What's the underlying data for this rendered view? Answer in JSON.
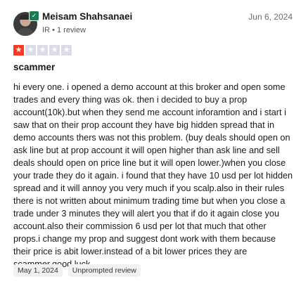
{
  "reviewer": {
    "name": "Meisam Shahsanaei",
    "country": "IR",
    "review_count": "1 review",
    "meta_separator": "•"
  },
  "review": {
    "date": "Jun 6, 2024",
    "rating": 1,
    "rating_max": 5,
    "title": "scammer",
    "text": "hi every one. i opened a demo account at this broker and open some trades and every thing was ok. then i decided to buy a prop account(10k).but when they send me account inforamtion and i start i saw that on their prop account they have big hidden spread that in demo accounts thers was not this problem. (buy deals should open on ask line but at prop account it will open higher than ask line and sell deals should open on price line but it will open lower.)when you close your trade they do it again. i found that they have 10 usd per lot hidden spread and it will annoy you very much if you scalp.also in their rules there is not written about minimum trading time but when you close a trade under 3 minutes they will alert you that if do it again close you account.also their commission 6 usd per lot that much that other props.i change my prop and suggest dont work with them because their price is abit lower.instead of a bit lower prices they are scammer.good luck"
  },
  "tags": [
    "May 1, 2024",
    "Unprompted review"
  ],
  "colors": {
    "star_filled": "#ff3722",
    "star_empty": "#dcdce6",
    "verified": "#1c7a55"
  }
}
